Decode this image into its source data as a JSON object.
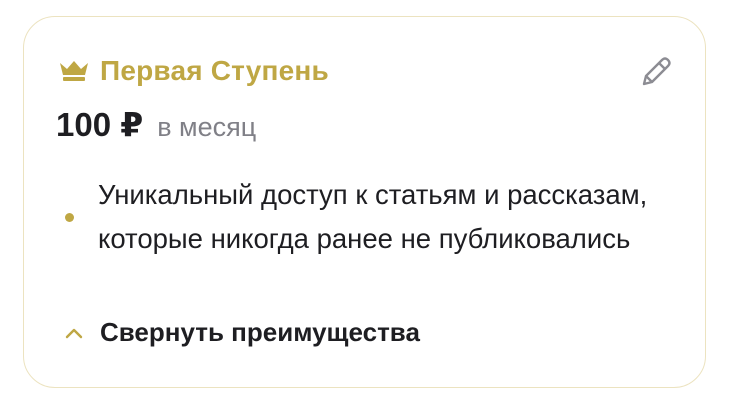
{
  "tier": {
    "icon": "crown-icon",
    "name": "Первая Ступень",
    "accent_color": "#bfa744"
  },
  "price": {
    "amount": "100 ₽",
    "period": "в месяц"
  },
  "actions": {
    "edit_icon": "pencil-icon"
  },
  "benefits": [
    {
      "text": "Уникальный доступ к статьям и рассказам, которые никогда ранее не публиковались"
    }
  ],
  "toggle": {
    "icon": "chevron-up-icon",
    "label": "Свернуть преимущества"
  }
}
